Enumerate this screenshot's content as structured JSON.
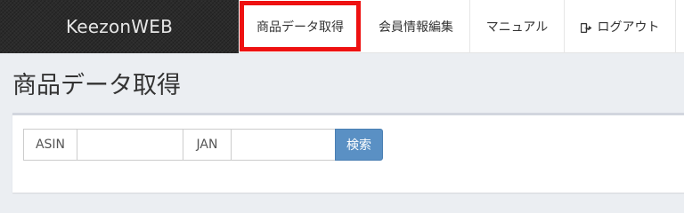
{
  "navbar": {
    "brand": "KeezonWEB",
    "items": [
      {
        "label": "商品データ取得",
        "active": true
      },
      {
        "label": "会員情報編集",
        "active": false
      },
      {
        "label": "マニュアル",
        "active": false
      },
      {
        "label": "ログアウト",
        "active": false,
        "icon": "logout-icon"
      }
    ]
  },
  "page": {
    "title": "商品データ取得"
  },
  "search": {
    "asin_label": "ASIN",
    "asin_value": "",
    "jan_label": "JAN",
    "jan_value": "",
    "submit_label": "検索"
  },
  "colors": {
    "active_highlight": "#ee1111",
    "button": "#5a90c4",
    "brand_bg": "#2b2b2b",
    "page_bg": "#ebeef2"
  }
}
